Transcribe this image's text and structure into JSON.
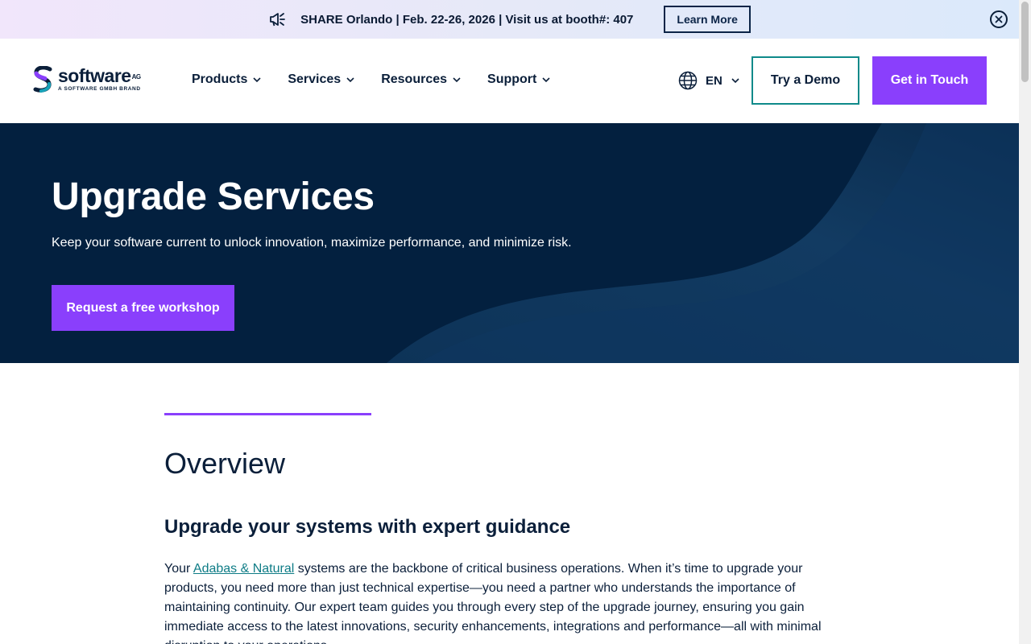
{
  "banner": {
    "icon": "megaphone-icon",
    "text": "SHARE Orlando | Feb. 22-26, 2026 | Visit us at booth#: 407",
    "learn_more": "Learn More",
    "close_icon": "close-circle-icon"
  },
  "header": {
    "logo": {
      "wordmark": "software",
      "superscript": "AG",
      "tagline": "A SOFTWARE GMBH BRAND"
    },
    "nav": [
      {
        "label": "Products"
      },
      {
        "label": "Services"
      },
      {
        "label": "Resources"
      },
      {
        "label": "Support"
      }
    ],
    "language": {
      "code": "EN",
      "icon": "globe-icon"
    },
    "try_demo": "Try a Demo",
    "get_in_touch": "Get in Touch"
  },
  "hero": {
    "title": "Upgrade Services",
    "subtitle": "Keep your software current to unlock innovation, maximize performance, and minimize risk.",
    "cta": "Request a free workshop"
  },
  "content": {
    "overview_title": "Overview",
    "subheading": "Upgrade your systems with expert guidance",
    "para_prefix": "Your ",
    "para_link": "Adabas & Natural",
    "para_rest": " systems are the backbone of critical business operations. When it’s time to upgrade your products, you need more than just technical expertise—you need a partner who understands the importance of maintaining continuity. Our expert team guides you through every step of the upgrade journey, ensuring you gain immediate access to the latest innovations, security enhancements, integrations and performance—all with minimal disruption to your operations."
  },
  "colors": {
    "accent_purple": "#8a3ffc",
    "hero_navy": "#03203f",
    "teal": "#0e8a8a",
    "text_dark": "#0b1f3a"
  }
}
